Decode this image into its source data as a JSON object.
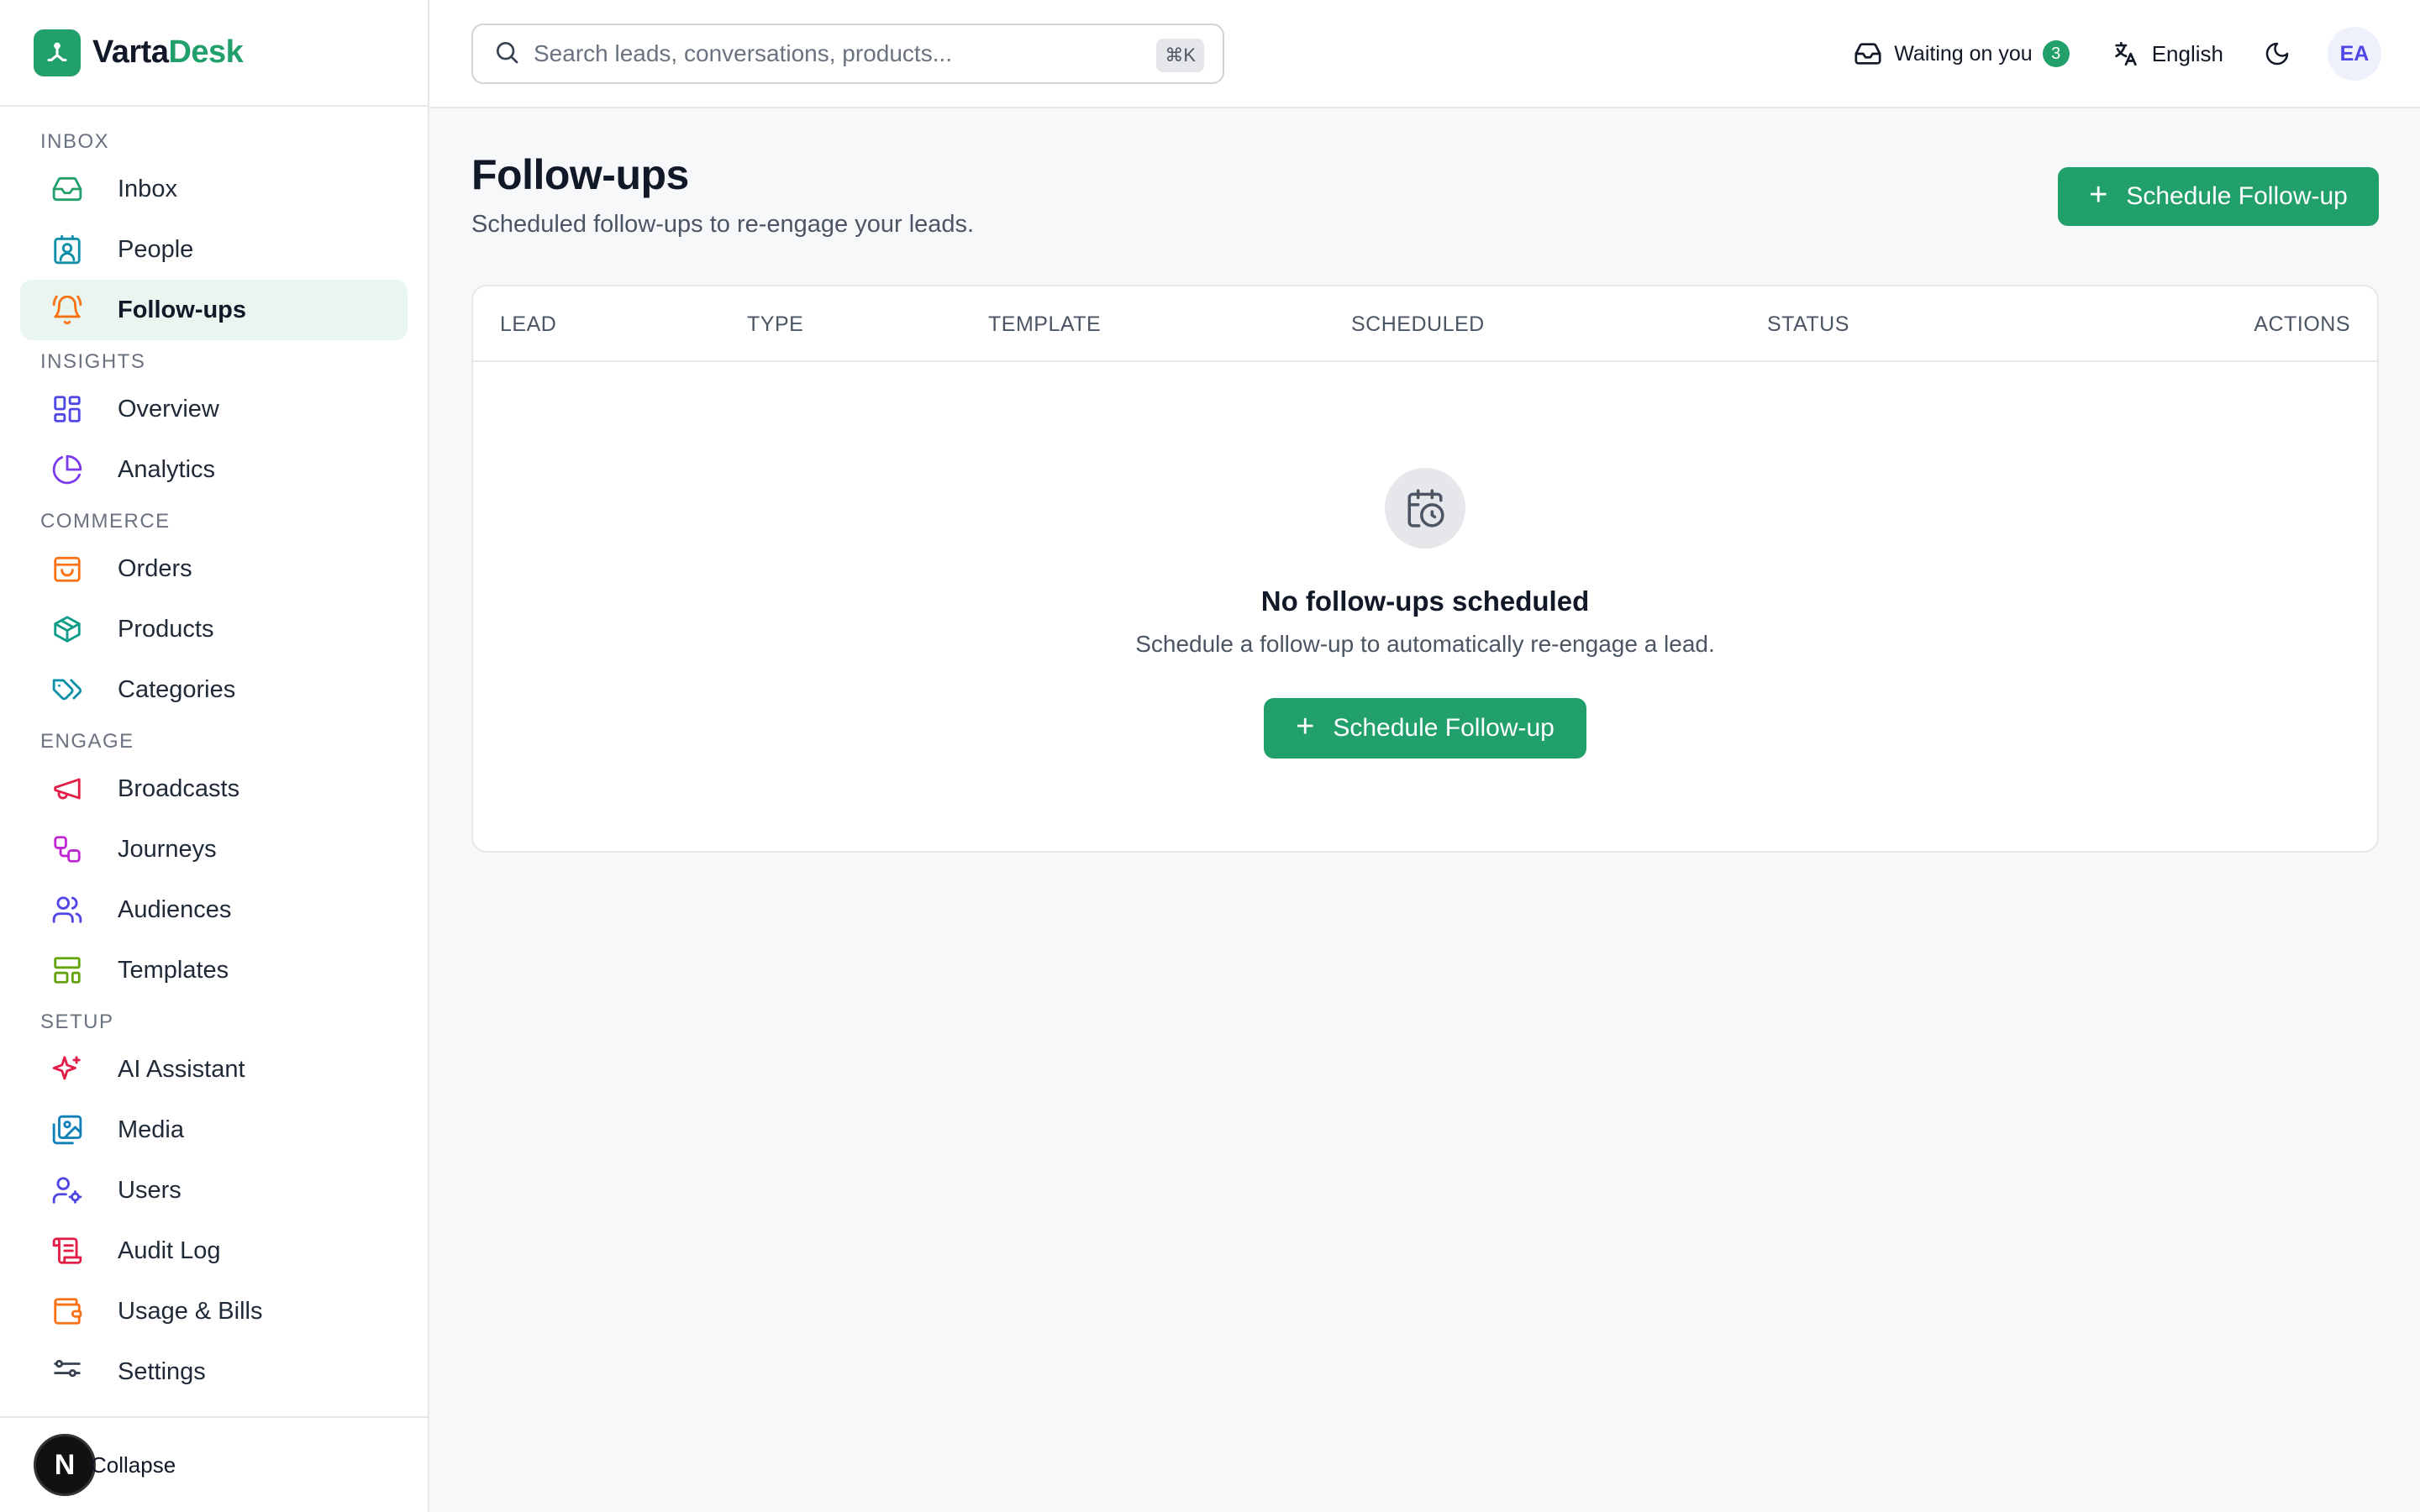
{
  "brand": {
    "name_v": "V",
    "name_arta": "arta",
    "name_desk": "Desk",
    "accent": "#22a06b"
  },
  "sidebar": {
    "sections": [
      {
        "label": "INBOX",
        "items": [
          {
            "label": "Inbox",
            "icon": "inbox-icon",
            "color": "#22a06b"
          },
          {
            "label": "People",
            "icon": "contact-card-icon",
            "color": "#0e8fa8"
          },
          {
            "label": "Follow-ups",
            "icon": "bell-ring-icon",
            "color": "#f97316",
            "active": true
          }
        ]
      },
      {
        "label": "INSIGHTS",
        "items": [
          {
            "label": "Overview",
            "icon": "dashboard-grid-icon",
            "color": "#4f46e5"
          },
          {
            "label": "Analytics",
            "icon": "pie-chart-icon",
            "color": "#7c3aed"
          }
        ]
      },
      {
        "label": "COMMERCE",
        "items": [
          {
            "label": "Orders",
            "icon": "shopping-bag-icon",
            "color": "#f97316"
          },
          {
            "label": "Products",
            "icon": "package-icon",
            "color": "#0f9d8a"
          },
          {
            "label": "Categories",
            "icon": "tags-icon",
            "color": "#0e8fa8"
          }
        ]
      },
      {
        "label": "ENGAGE",
        "items": [
          {
            "label": "Broadcasts",
            "icon": "megaphone-icon",
            "color": "#e11d48"
          },
          {
            "label": "Journeys",
            "icon": "workflow-icon",
            "color": "#c026d3"
          },
          {
            "label": "Audiences",
            "icon": "users-icon",
            "color": "#4f46e5"
          },
          {
            "label": "Templates",
            "icon": "layout-template-icon",
            "color": "#65a30d"
          }
        ]
      },
      {
        "label": "SETUP",
        "items": [
          {
            "label": "AI Assistant",
            "icon": "sparkles-icon",
            "color": "#e11d48"
          },
          {
            "label": "Media",
            "icon": "images-icon",
            "color": "#0e7fb8"
          },
          {
            "label": "Users",
            "icon": "user-cog-icon",
            "color": "#4f46e5"
          },
          {
            "label": "Audit Log",
            "icon": "scroll-icon",
            "color": "#e11d48"
          },
          {
            "label": "Usage & Bills",
            "icon": "wallet-icon",
            "color": "#f97316"
          },
          {
            "label": "Settings",
            "icon": "sliders-icon",
            "color": "#374151"
          }
        ]
      }
    ],
    "footer": {
      "badge": "N",
      "collapse_label": "Collapse"
    }
  },
  "topbar": {
    "search_placeholder": "Search leads, conversations, products...",
    "search_shortcut": "⌘K",
    "waiting_label": "Waiting on you",
    "waiting_count": "3",
    "language": "English",
    "avatar_initials": "EA"
  },
  "page": {
    "title": "Follow-ups",
    "subtitle": "Scheduled follow-ups to re-engage your leads.",
    "primary_action": "Schedule Follow-up"
  },
  "table": {
    "columns": [
      "LEAD",
      "TYPE",
      "TEMPLATE",
      "SCHEDULED",
      "STATUS",
      "ACTIONS"
    ],
    "empty_title": "No follow-ups scheduled",
    "empty_subtitle": "Schedule a follow-up to automatically re-engage a lead.",
    "empty_action": "Schedule Follow-up"
  }
}
